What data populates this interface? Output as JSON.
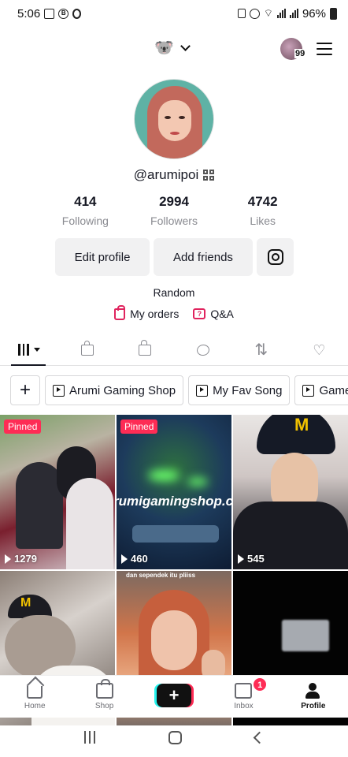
{
  "status_bar": {
    "time": "5:06",
    "battery": "96%"
  },
  "header": {
    "account_emoji": "🐨",
    "story_count": "99"
  },
  "profile": {
    "username": "@arumipoi",
    "stats": [
      {
        "value": "414",
        "label": "Following"
      },
      {
        "value": "2994",
        "label": "Followers"
      },
      {
        "value": "4742",
        "label": "Likes"
      }
    ],
    "edit_label": "Edit profile",
    "friends_label": "Add friends",
    "bio": "Random",
    "orders_label": "My orders",
    "qa_label": "Q&A"
  },
  "playlists": [
    "Arumi Gaming Shop",
    "My Fav Song",
    "Game"
  ],
  "videos": [
    {
      "pinned": "Pinned",
      "views": "1279"
    },
    {
      "pinned": "Pinned",
      "views": "460",
      "overlay": "rumigamingshop.c"
    },
    {
      "views": "545"
    },
    {},
    {
      "caption": "dan sependek itu pliiss"
    },
    {}
  ],
  "bottom_nav": {
    "home": "Home",
    "shop": "Shop",
    "inbox": "Inbox",
    "inbox_badge": "1",
    "profile": "Profile",
    "create": "+"
  },
  "colors": {
    "accent": "#fe2c55",
    "cyan": "#25f4ee",
    "link_icon": "#e0245e"
  }
}
